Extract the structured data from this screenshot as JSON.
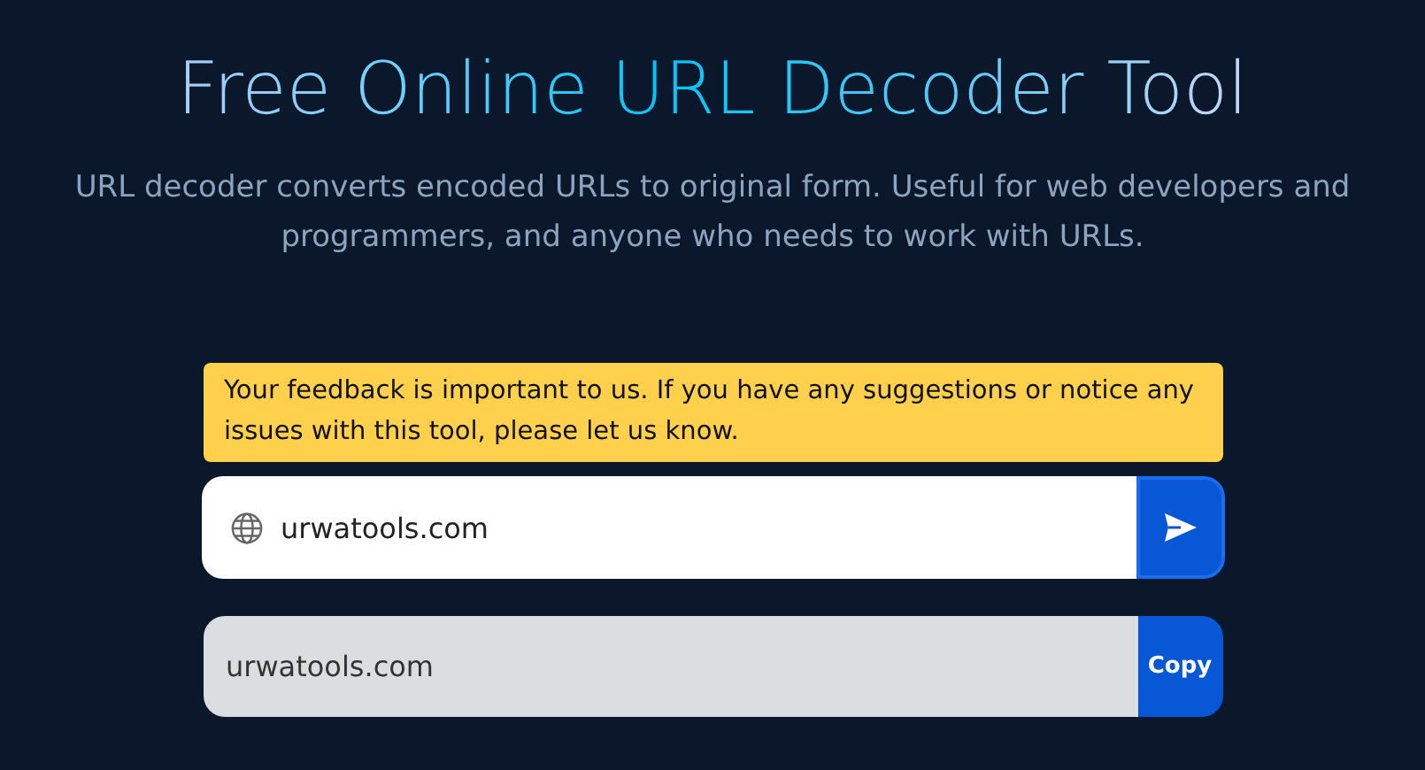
{
  "header": {
    "title": "Free Online URL Decoder Tool",
    "subtitle": "URL decoder converts encoded URLs to original form. Useful for web developers and programmers, and anyone who needs to work with URLs."
  },
  "notice": {
    "text": "Your feedback is important to us. If you have any suggestions or notice any issues with this tool, please let us know."
  },
  "input": {
    "value": "urwatools.com"
  },
  "output": {
    "value": "urwatools.com",
    "button": "Copy"
  }
}
